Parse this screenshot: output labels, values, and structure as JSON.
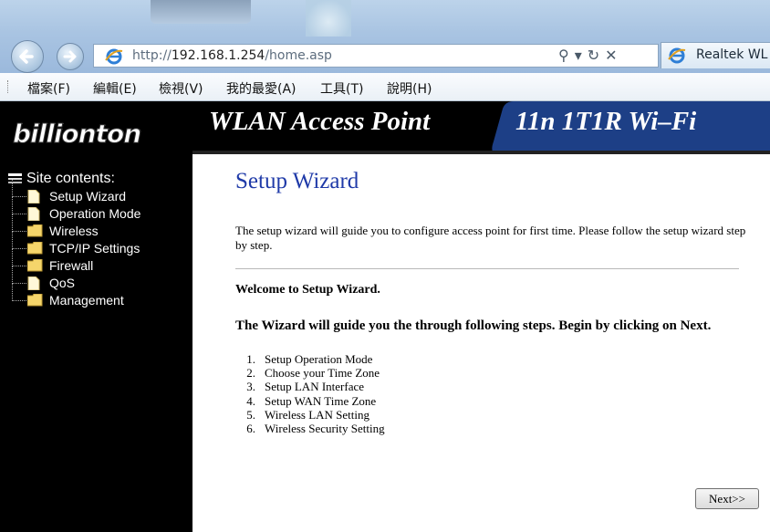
{
  "browser": {
    "address": {
      "prefix": "http://",
      "host": "192.168.1.254",
      "path": "/home.asp"
    },
    "tab_title": "Realtek WL",
    "menu": [
      "檔案(F)",
      "編輯(E)",
      "檢視(V)",
      "我的最愛(A)",
      "工具(T)",
      "說明(H)"
    ]
  },
  "router": {
    "logo": "billionton",
    "banner_left": "WLAN Access Point",
    "banner_right": "11n 1T1R Wi–Fi",
    "sidebar": {
      "root_label": "Site contents:",
      "items": [
        {
          "label": "Setup Wizard",
          "icon": "page-icon"
        },
        {
          "label": "Operation Mode",
          "icon": "page-icon"
        },
        {
          "label": "Wireless",
          "icon": "folder-icon"
        },
        {
          "label": "TCP/IP Settings",
          "icon": "folder-icon"
        },
        {
          "label": "Firewall",
          "icon": "folder-icon"
        },
        {
          "label": "QoS",
          "icon": "page-icon"
        },
        {
          "label": "Management",
          "icon": "folder-icon"
        }
      ]
    },
    "main": {
      "title": "Setup Wizard",
      "intro": "The setup wizard will guide you to configure access point for first time. Please follow the setup wizard step by step.",
      "welcome": "Welcome to Setup Wizard.",
      "guide": "The Wizard will guide you the through following steps. Begin by clicking on Next.",
      "steps": [
        {
          "num": "1.",
          "text": "Setup Operation Mode"
        },
        {
          "num": "2.",
          "text": "Choose your Time Zone"
        },
        {
          "num": "3.",
          "text": "Setup LAN Interface"
        },
        {
          "num": "4.",
          "text": "Setup WAN Time Zone"
        },
        {
          "num": "5.",
          "text": "Wireless LAN Setting"
        },
        {
          "num": "6.",
          "text": "Wireless Security Setting"
        }
      ],
      "next_label": "Next>>"
    }
  }
}
